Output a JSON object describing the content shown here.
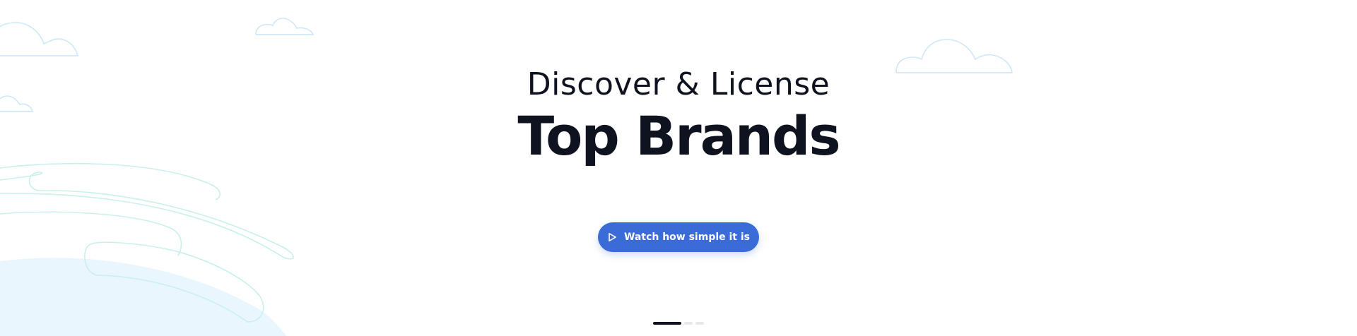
{
  "hero": {
    "subtitle": "Discover & License",
    "title": "Top Brands",
    "cta_label": "Watch how simple it is",
    "cta_icon": "play-icon",
    "slides": {
      "count": 3,
      "active_index": 0
    }
  },
  "colors": {
    "accent": "#3b6bd6",
    "text": "#0f1320",
    "cloud_stroke": "#cfe8f7",
    "wave_stroke": "#c9f0ec",
    "blob_fill": "#eaf6fd"
  }
}
